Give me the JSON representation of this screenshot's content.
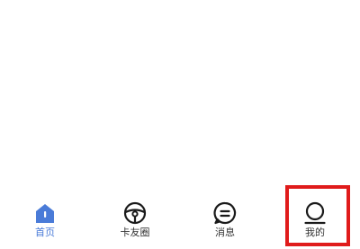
{
  "tabbar": {
    "items": [
      {
        "label": "首页",
        "icon": "home-icon",
        "active": true
      },
      {
        "label": "卡友圈",
        "icon": "steering-wheel-icon",
        "active": false
      },
      {
        "label": "消息",
        "icon": "message-bubble-icon",
        "active": false
      },
      {
        "label": "我的",
        "icon": "user-profile-icon",
        "active": false
      }
    ]
  },
  "colors": {
    "accent": "#4a7bd8",
    "text": "#333333",
    "icon_stroke": "#1a1a1a",
    "highlight": "#e01b1b",
    "background": "#ffffff"
  }
}
